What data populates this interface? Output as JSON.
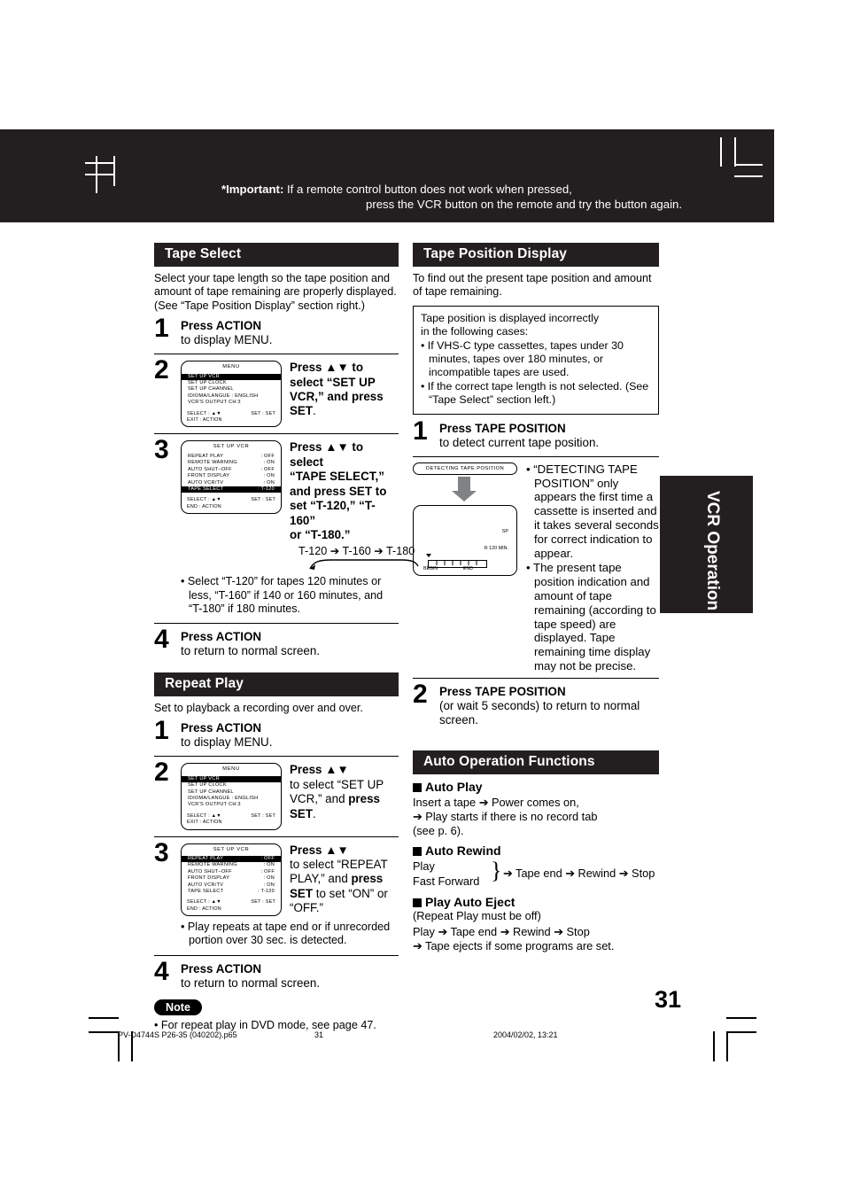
{
  "important": {
    "label": "*Important:",
    "line1": "If a remote control button does not work when pressed,",
    "line2": "press the VCR button on the remote and try the button again."
  },
  "side_tab": {
    "label": "VCR Operation"
  },
  "page_number": "31",
  "footer": {
    "file": "PV-D4744S P26-35 (040202).p65",
    "page": "31",
    "date": "2004/02/02, 13:21"
  },
  "tape_select": {
    "heading": "Tape Select",
    "intro1": "Select your tape length so the tape position and amount of tape remaining are properly displayed.",
    "intro2": "(See “Tape Position Display” section right.)",
    "step1": {
      "num": "1",
      "bold": "Press ACTION",
      "rest": "to display MENU."
    },
    "step2": {
      "num": "2",
      "text_pre": "Press ▲▼ to select “SET UP VCR,” and ",
      "text_bold": "press SET",
      "text_post": ".",
      "osd": {
        "title": "MENU",
        "rows": [
          {
            "label": "SET  UP  VCR",
            "value": "",
            "highlight": true
          },
          {
            "label": "SET  UP  CLOCK",
            "value": "",
            "highlight": false
          },
          {
            "label": "SET  UP  CHANNEL",
            "value": "",
            "highlight": false
          },
          {
            "label": "IDIOMA/LANGUE : ENGLISH",
            "value": "",
            "highlight": false
          },
          {
            "label": "VCR’S  OUTPUT  CH:3",
            "value": "",
            "highlight": false
          }
        ],
        "foot_left1": "SELECT :  ▲▼",
        "foot_right1": "SET : SET",
        "foot_left2": "EXIT       : ACTION"
      }
    },
    "step3": {
      "num": "3",
      "line1": "Press ▲▼ to select",
      "line2": "“TAPE SELECT,”",
      "line3_pre": "and ",
      "line3_bold": "press SET",
      "line3_post": " to",
      "line4": "set “T-120,” “T-160”",
      "line5": "or “T-180.”",
      "cycle": "T-120  ➔  T-160  ➔  T-180",
      "osd": {
        "title": "SET  UP  VCR",
        "rows": [
          {
            "label": "REPEAT  PLAY",
            "value": ": OFF",
            "highlight": false
          },
          {
            "label": "REMOTE  WARNING",
            "value": ": ON",
            "highlight": false
          },
          {
            "label": "AUTO  SHUT–OFF",
            "value": ": OFF",
            "highlight": false
          },
          {
            "label": "FRONT  DISPLAY",
            "value": ": ON",
            "highlight": false
          },
          {
            "label": "AUTO  VCR/TV",
            "value": ": ON",
            "highlight": false
          },
          {
            "label": "TAPE  SELECT",
            "value": ": T-120",
            "highlight": true
          }
        ],
        "foot_left1": "SELECT : ▲▼",
        "foot_right1": "SET : SET",
        "foot_left2": "END       : ACTION"
      },
      "bullet": "• Select “T-120” for tapes 120 minutes or less, “T-160” if 140 or 160 minutes, and “T-180” if 180 minutes."
    },
    "step4": {
      "num": "4",
      "bold": "Press ACTION",
      "rest": "to return to normal screen."
    }
  },
  "repeat_play": {
    "heading": "Repeat Play",
    "intro": "Set to playback a recording over and over.",
    "step1": {
      "num": "1",
      "bold": "Press ACTION",
      "rest": "to display MENU."
    },
    "step2": {
      "num": "2",
      "line1": "Press ▲▼",
      "line2": "to select “SET UP",
      "line3_pre": "VCR,” and ",
      "line3_bold": "press",
      "line4_bold": "SET",
      "line4_post": ".",
      "osd": {
        "title": "MENU",
        "rows": [
          {
            "label": "SET  UP  VCR",
            "value": "",
            "highlight": true
          },
          {
            "label": "SET  UP  CLOCK",
            "value": "",
            "highlight": false
          },
          {
            "label": "SET  UP  CHANNEL",
            "value": "",
            "highlight": false
          },
          {
            "label": "IDIOMA/LANGUE : ENGLISH",
            "value": "",
            "highlight": false
          },
          {
            "label": "VCR’S  OUTPUT  CH:3",
            "value": "",
            "highlight": false
          }
        ],
        "foot_left1": "SELECT :  ▲▼",
        "foot_right1": "SET : SET",
        "foot_left2": "EXIT       : ACTION"
      }
    },
    "step3": {
      "num": "3",
      "line1": "Press ▲▼",
      "line2": "to select “REPEAT",
      "line3_pre": "PLAY,” and ",
      "line3_bold": "press",
      "line4_bold": "SET",
      "line4_post": " to set “ON” or",
      "line5": "“OFF.”",
      "osd": {
        "title": "SET  UP  VCR",
        "rows": [
          {
            "label": "REPEAT  PLAY",
            "value": ": OFF",
            "highlight": true
          },
          {
            "label": "REMOTE  WARNING",
            "value": ": ON",
            "highlight": false
          },
          {
            "label": "AUTO  SHUT–OFF",
            "value": ": OFF",
            "highlight": false
          },
          {
            "label": "FRONT  DISPLAY",
            "value": ": ON",
            "highlight": false
          },
          {
            "label": "AUTO  VCR/TV",
            "value": ": ON",
            "highlight": false
          },
          {
            "label": "TAPE  SELECT",
            "value": ": T-120",
            "highlight": false
          }
        ],
        "foot_left1": "SELECT : ▲▼",
        "foot_right1": "SET : SET",
        "foot_left2": "END       : ACTION"
      },
      "bullet": "• Play repeats at tape end or if unrecorded portion over 30 sec. is detected."
    },
    "step4": {
      "num": "4",
      "bold": "Press ACTION",
      "rest": "to return to normal screen."
    },
    "note_label": "Note",
    "note_text": "• For repeat play in DVD mode, see page 47."
  },
  "tape_position_display": {
    "heading": "Tape Position Display",
    "intro": "To find out the present tape position and amount of tape remaining.",
    "warning": {
      "line1": "Tape position is displayed incorrectly",
      "line2": "in the following cases:",
      "bullet1": "• If VHS-C type cassettes, tapes under 30 minutes, tapes over 180 minutes, or incompatible tapes are used.",
      "bullet2": "• If the correct tape length is not selected. (See “Tape Select” section left.)"
    },
    "step1": {
      "num": "1",
      "bold": "Press TAPE POSITION",
      "rest": "to detect current tape position."
    },
    "graphic": {
      "detecting_label": "DETECTING  TAPE  POSITION",
      "screen_sp": "SP",
      "screen_remaining": "R 120 MIN.",
      "screen_begin": "BEGIN",
      "screen_end": "END"
    },
    "bullets": [
      "• “DETECTING TAPE POSITION” only appears the first time a cassette is inserted and it takes several seconds for correct indication to appear.",
      "• The present tape position indication and amount of tape remaining (according to tape speed) are displayed. Tape remaining time display may not be precise."
    ],
    "step2": {
      "num": "2",
      "bold": "Press TAPE POSITION",
      "rest": "(or wait 5 seconds) to return to normal  screen."
    }
  },
  "auto_operation": {
    "heading": "Auto Operation Functions",
    "auto_play": {
      "title": "Auto Play",
      "line1": "Insert a tape ➔ Power comes on,",
      "line2": "➔ Play starts if there is no record tab",
      "line3": "(see p. 6)."
    },
    "auto_rewind": {
      "title": "Auto Rewind",
      "play": "Play",
      "fast_forward": "Fast Forward",
      "flow": "➔ Tape end ➔ Rewind ➔ Stop"
    },
    "play_auto_eject": {
      "title": "Play Auto Eject",
      "sub": "(Repeat Play must be off)",
      "line1": "Play ➔ Tape end ➔ Rewind ➔ Stop",
      "line2": "➔ Tape ejects if some programs are set."
    }
  }
}
